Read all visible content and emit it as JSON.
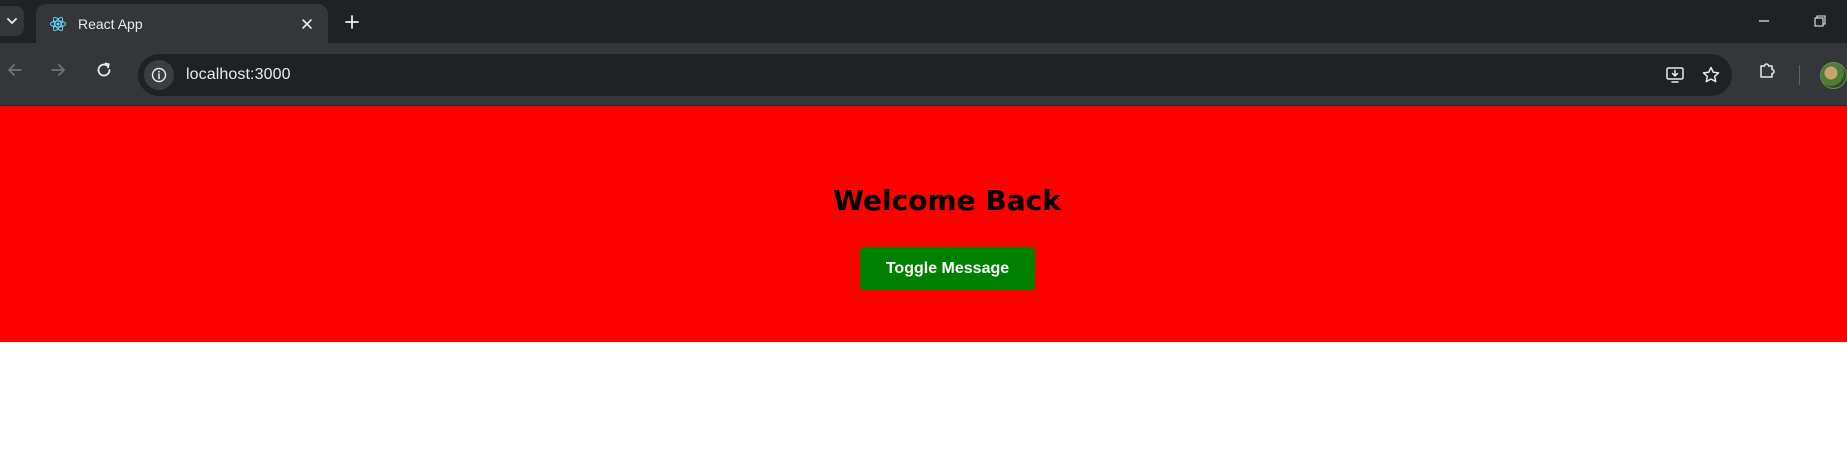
{
  "browser": {
    "tab": {
      "title": "React App",
      "favicon": "react-logo-icon"
    },
    "address_bar": {
      "url": "localhost:3000"
    },
    "icons": {
      "tab_search": "chevron-down-icon",
      "tab_close": "close-icon",
      "new_tab": "plus-icon",
      "minimize": "minimize-icon",
      "restore": "restore-icon",
      "back": "arrow-left-icon",
      "forward": "arrow-right-icon",
      "reload": "reload-icon",
      "site_info": "info-icon",
      "install_app": "install-app-icon",
      "bookmark": "star-icon",
      "extensions": "puzzle-icon",
      "profile": "avatar"
    }
  },
  "page": {
    "heading": "Welcome Back",
    "toggle_button_label": "Toggle Message"
  },
  "colors": {
    "hero_background": "#ff0000",
    "button_background": "#008000",
    "button_text": "#ffffff",
    "heading_text": "#000000",
    "browser_frame": "#202124",
    "toolbar": "#35363a"
  }
}
